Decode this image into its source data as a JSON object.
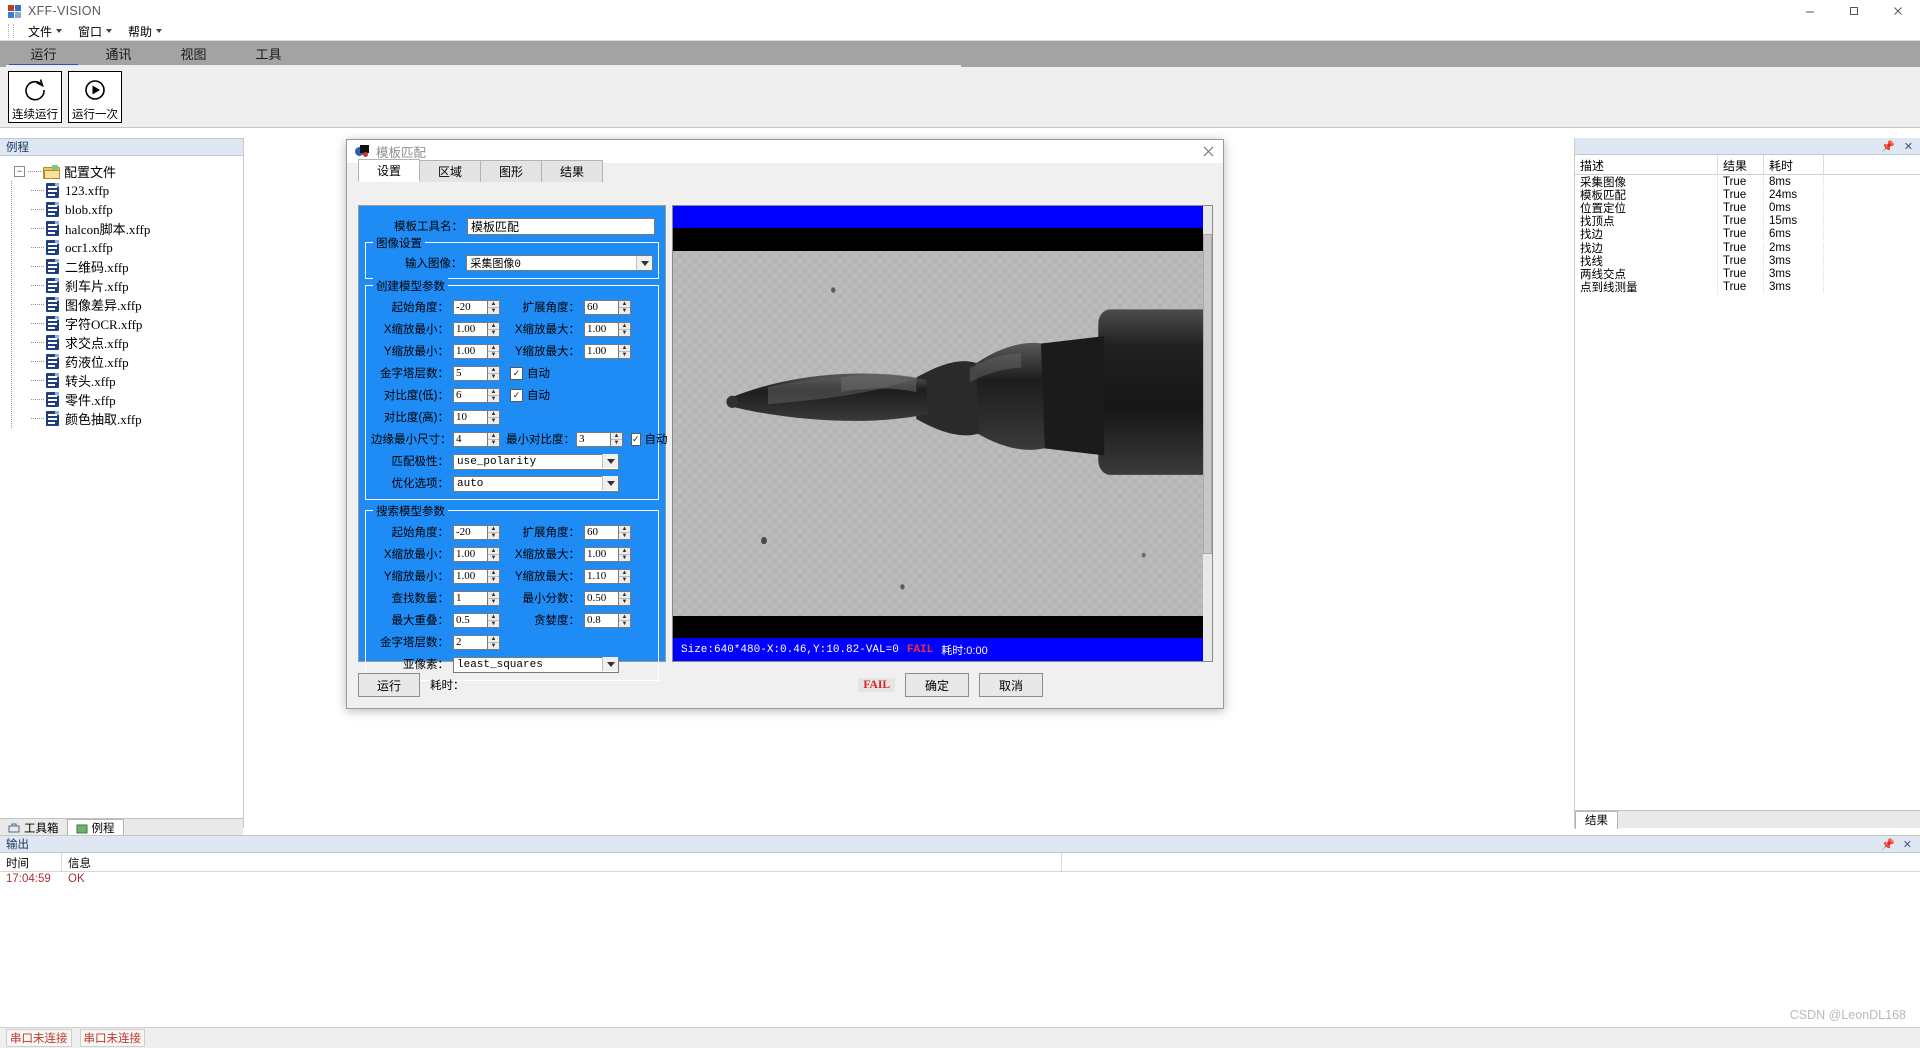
{
  "window": {
    "title": "XFF-VISION",
    "minimize": "─",
    "maximize": "☐",
    "close": "✕"
  },
  "menubar": {
    "items": [
      "文件",
      "窗口",
      "帮助"
    ]
  },
  "ribbon": {
    "tabs": [
      "运行",
      "通讯",
      "视图",
      "工具"
    ],
    "selected": "运行",
    "buttons": [
      {
        "label": "连续运行",
        "icon": "refresh-loop-icon"
      },
      {
        "label": "运行一次",
        "icon": "play-circle-icon"
      }
    ]
  },
  "left_panel": {
    "caption": "例程",
    "root": "配置文件",
    "files": [
      "123.xffp",
      "blob.xffp",
      "halcon脚本.xffp",
      "ocr1.xffp",
      "二维码.xffp",
      "刹车片.xffp",
      "图像差异.xffp",
      "字符OCR.xffp",
      "求交点.xffp",
      "药液位.xffp",
      "转头.xffp",
      "零件.xffp",
      "颜色抽取.xffp"
    ],
    "bottom_tabs": [
      "工具箱",
      "例程"
    ],
    "bottom_tab_selected": "例程"
  },
  "results_panel": {
    "caption": "",
    "columns": [
      "描述",
      "结果",
      "耗时"
    ],
    "rows": [
      {
        "desc": "采集图像",
        "result": "True",
        "time": "8ms"
      },
      {
        "desc": "模板匹配",
        "result": "True",
        "time": "24ms"
      },
      {
        "desc": "位置定位",
        "result": "True",
        "time": "0ms"
      },
      {
        "desc": "找顶点",
        "result": "True",
        "time": "15ms"
      },
      {
        "desc": "找边",
        "result": "True",
        "time": "6ms"
      },
      {
        "desc": "找边",
        "result": "True",
        "time": "2ms"
      },
      {
        "desc": "找线",
        "result": "True",
        "time": "3ms"
      },
      {
        "desc": "两线交点",
        "result": "True",
        "time": "3ms"
      },
      {
        "desc": "点到线测量",
        "result": "True",
        "time": "3ms"
      }
    ],
    "footer_tab": "结果"
  },
  "output_panel": {
    "caption": "输出",
    "columns": [
      "时间",
      "信息"
    ],
    "rows": [
      {
        "time": "17:04:59",
        "message": "OK"
      }
    ]
  },
  "statusbar": {
    "items": [
      "串口未连接",
      "串口未连接"
    ]
  },
  "watermark": "CSDN @LeonDL168",
  "dialog": {
    "title": "模板匹配",
    "close": "✕",
    "tabs": [
      "设置",
      "区域",
      "图形",
      "结果"
    ],
    "selected_tab": "设置",
    "tool_name_label": "模板工具名：",
    "tool_name_value": "模板匹配",
    "image_settings": {
      "caption": "图像设置",
      "input_image_label": "输入图像：",
      "input_image_value": "采集图像0"
    },
    "create_model": {
      "caption": "创建模型参数",
      "start_angle_label": "起始角度：",
      "start_angle_value": "-20",
      "extend_angle_label": "扩展角度：",
      "extend_angle_value": "60",
      "xscale_min_label": "X缩放最小：",
      "xscale_min_value": "1.00",
      "xscale_max_label": "X缩放最大：",
      "xscale_max_value": "1.00",
      "yscale_min_label": "Y缩放最小：",
      "yscale_min_value": "1.00",
      "yscale_max_label": "Y缩放最大：",
      "yscale_max_value": "1.00",
      "pyramid_label": "金字塔层数：",
      "pyramid_value": "5",
      "pyramid_auto_label": "自动",
      "pyramid_auto_checked": true,
      "contrast_low_label": "对比度(低)：",
      "contrast_low_value": "6",
      "contrast_low_auto_label": "自动",
      "contrast_low_auto_checked": true,
      "contrast_high_label": "对比度(高)：",
      "contrast_high_value": "10",
      "min_edge_size_label": "边缘最小尺寸：",
      "min_edge_size_value": "4",
      "min_contrast_label": "最小对比度：",
      "min_contrast_value": "3",
      "min_contrast_auto_label": "自动",
      "min_contrast_auto_checked": true,
      "polarity_label": "匹配极性：",
      "polarity_value": "use_polarity",
      "optimize_label": "优化选项：",
      "optimize_value": "auto"
    },
    "search_model": {
      "caption": "搜索模型参数",
      "start_angle_label": "起始角度：",
      "start_angle_value": "-20",
      "extend_angle_label": "扩展角度：",
      "extend_angle_value": "60",
      "xscale_min_label": "X缩放最小：",
      "xscale_min_value": "1.00",
      "xscale_max_label": "X缩放最大：",
      "xscale_max_value": "1.00",
      "yscale_min_label": "Y缩放最小：",
      "yscale_min_value": "1.00",
      "yscale_max_label": "Y缩放最大：",
      "yscale_max_value": "1.10",
      "find_count_label": "查找数量：",
      "find_count_value": "1",
      "min_score_label": "最小分数：",
      "min_score_value": "0.50",
      "max_overlap_label": "最大重叠：",
      "max_overlap_value": "0.5",
      "greediness_label": "贪婪度：",
      "greediness_value": "0.8",
      "pyramid_label": "金字塔层数：",
      "pyramid_value": "2",
      "subpixel_label": "亚像素：",
      "subpixel_value": "least_squares"
    },
    "footer": {
      "run_label": "运行",
      "elapsed_label": "耗时：",
      "status_chip": "FAIL",
      "ok_label": "确定",
      "cancel_label": "取消"
    },
    "image_status": {
      "info": "Size:640*480-X:0.46,Y:10.82-VAL=0",
      "fail": "FAIL",
      "elapsed": "耗时:0:00"
    }
  },
  "colors": {
    "dialog_panel_blue": "#1f8cf5",
    "ribbon_gray": "#a3a3a3",
    "accent_blue": "#2a4fd6",
    "fail_red": "#e02020",
    "image_bar_blue": "#0000ff"
  }
}
